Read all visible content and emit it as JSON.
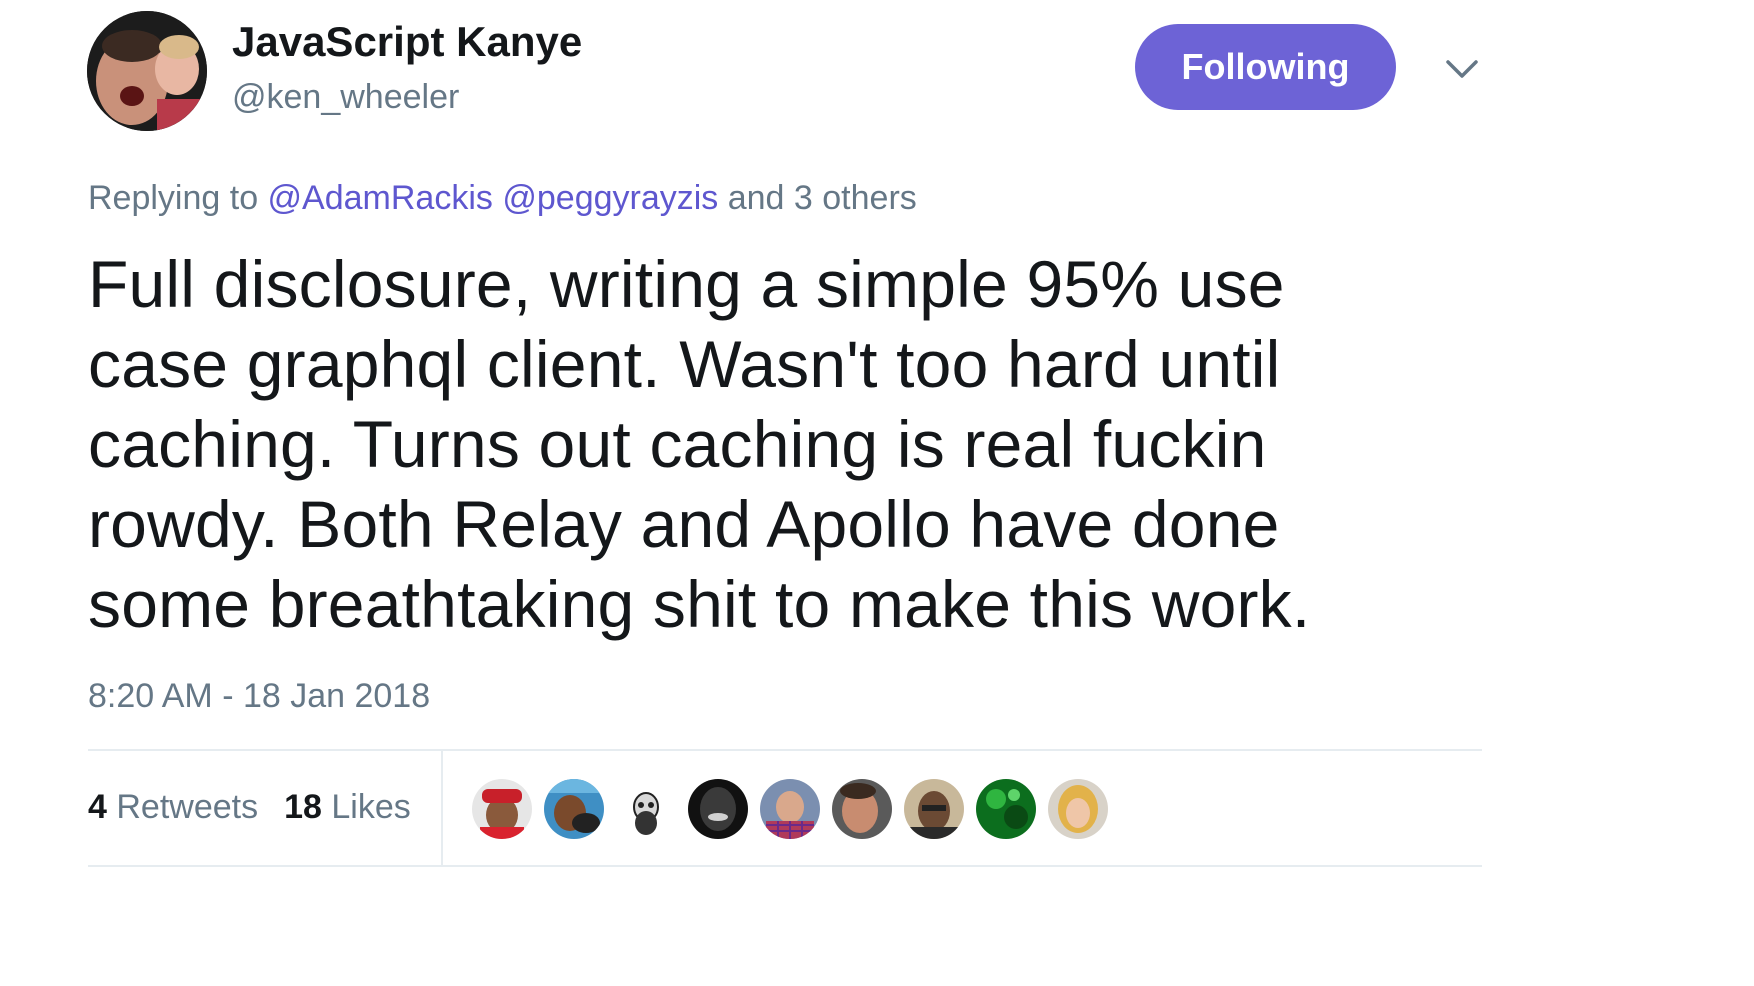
{
  "author": {
    "name": "JavaScript Kanye",
    "handle": "@ken_wheeler"
  },
  "follow_button_label": "Following",
  "reply": {
    "prefix": "Replying to ",
    "mentions": [
      "@AdamRackis",
      "@peggyrayzis"
    ],
    "suffix": " and 3 others"
  },
  "tweet": {
    "text": "Full disclosure, writing a simple 95% use\ncase graphql client. Wasn't too hard until\ncaching. Turns out caching is real fuckin\nrowdy. Both Relay and Apollo have done\nsome breathtaking shit to make this work.",
    "timestamp": "8:20 AM - 18 Jan 2018"
  },
  "stats": {
    "retweets_count": "4",
    "retweets_label": " Retweets",
    "likes_count": "18",
    "likes_label": " Likes"
  },
  "colors": {
    "accent": "#6d63d6",
    "link": "#5e57cf",
    "secondary_text": "#657786",
    "primary_text": "#14171a"
  },
  "icons": {
    "menu": "chevron-down-icon"
  }
}
